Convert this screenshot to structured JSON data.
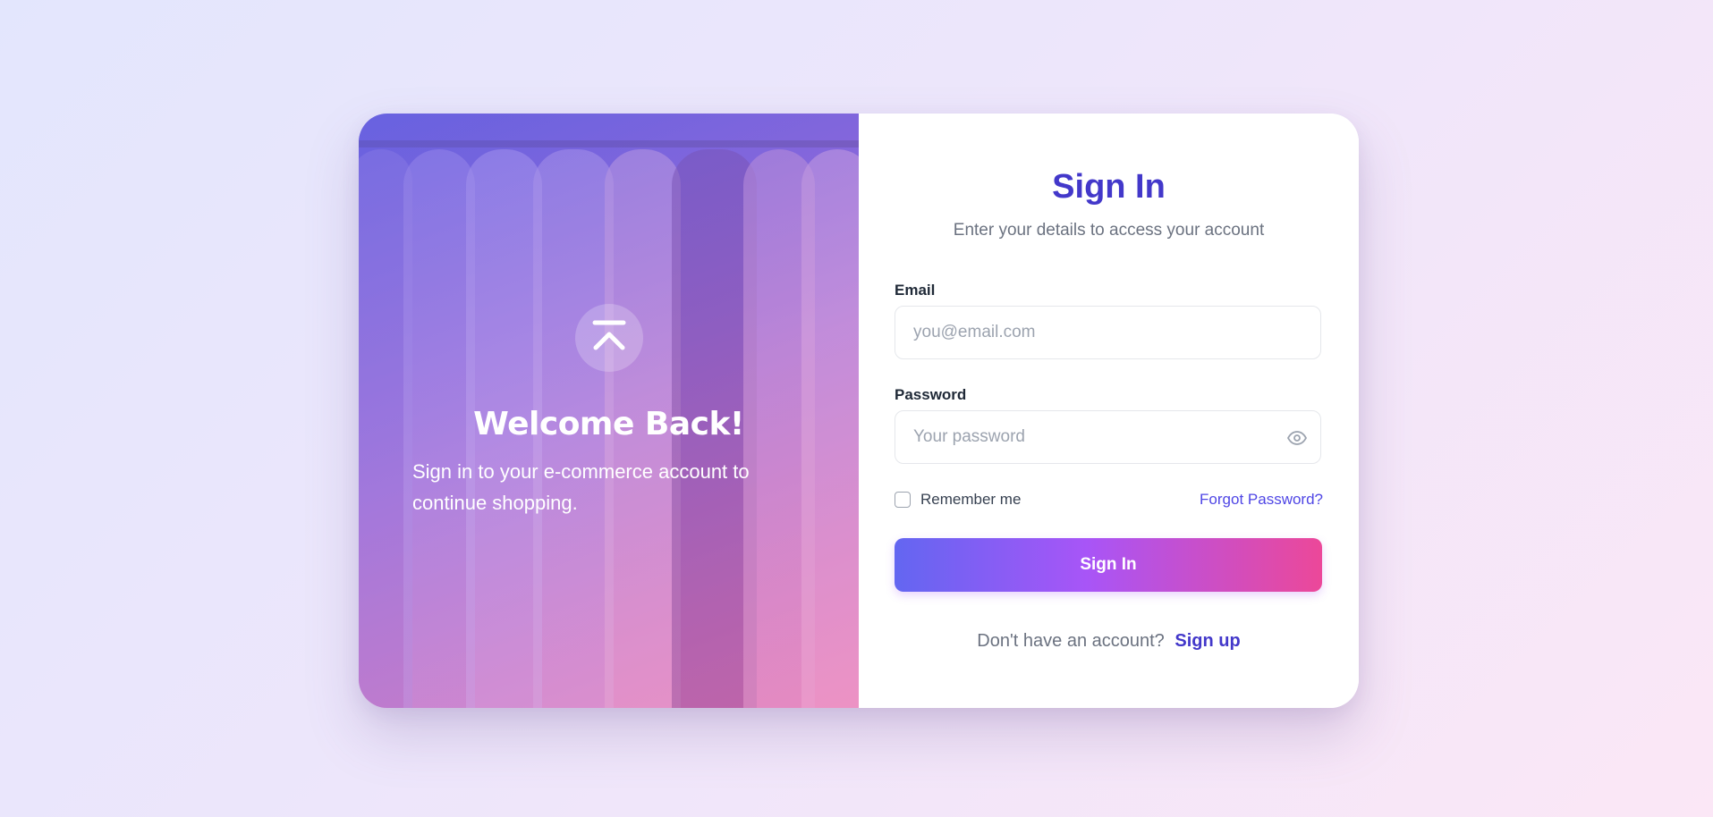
{
  "hero": {
    "logo_icon": "chevron-up-bar-icon",
    "heading": "Welcome Back!",
    "subtext": "Sign in to your e-commerce account to continue shopping."
  },
  "form": {
    "title": "Sign In",
    "subtitle": "Enter your details to access your account",
    "email": {
      "label": "Email",
      "placeholder": "you@email.com",
      "value": ""
    },
    "password": {
      "label": "Password",
      "placeholder": "Your password",
      "value": "",
      "toggle_icon": "eye-icon"
    },
    "remember_label": "Remember me",
    "remember_checked": false,
    "forgot_label": "Forgot Password?",
    "submit_label": "Sign In",
    "signup_prompt": "Don't have an account?",
    "signup_link": "Sign up"
  },
  "colors": {
    "accent": "#4338ca",
    "button_gradient_start": "#6366f1",
    "button_gradient_mid": "#a855f7",
    "button_gradient_end": "#ec4899",
    "link": "#4f46e5"
  }
}
